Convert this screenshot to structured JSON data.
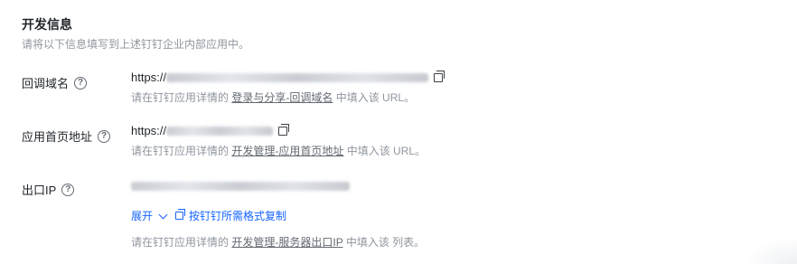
{
  "section": {
    "title": "开发信息",
    "description": "请将以下信息填写到上述钉钉企业内部应用中。"
  },
  "rows": {
    "callback": {
      "label": "回调域名",
      "value_prefix": "https://",
      "hint_prefix": "请在钉钉应用详情的",
      "hint_link": "登录与分享-回调域名",
      "hint_suffix": "中填入该 URL。"
    },
    "homepage": {
      "label": "应用首页地址",
      "value_prefix": "https://",
      "hint_prefix": "请在钉钉应用详情的",
      "hint_link": "开发管理-应用首页地址",
      "hint_suffix": "中填入该 URL。"
    },
    "egress_ip": {
      "label": "出口IP",
      "expand_label": "展开",
      "copy_label": "按钉钉所需格式复制",
      "hint_prefix": "请在钉钉应用详情的",
      "hint_link": "开发管理-服务器出口IP",
      "hint_suffix": "中填入该 列表。"
    }
  },
  "icons": {
    "help": "question-circle-icon",
    "copy": "copy-icon",
    "expand": "chevron-down-icon"
  },
  "colors": {
    "link_blue": "#1664ff",
    "muted_text": "#8f959e"
  }
}
